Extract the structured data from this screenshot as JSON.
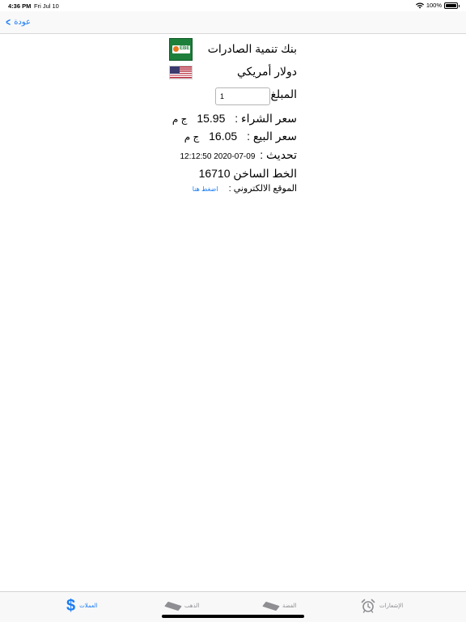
{
  "status_bar": {
    "time": "4:36 PM",
    "date": "Fri Jul 10",
    "battery": "100%",
    "battery_level": 1.0
  },
  "nav": {
    "back_label": "عودة"
  },
  "bank": {
    "name": "بنك تنمية الصادرات",
    "logo_text": "EBE",
    "currency": "دولار أمريكي",
    "amount_label": "المبلغ",
    "amount_value": "1",
    "buy_label": "سعر الشراء :",
    "buy_value": "15.95",
    "sell_label": "سعر البيع :",
    "sell_value": "16.05",
    "unit": "ج م",
    "update_label": "تحديث :",
    "update_value": "09-07-2020 12:12:50",
    "hotline_label": "الخط الساخن",
    "hotline_value": "16710",
    "website_label": "الموقع الالكتروني :",
    "website_link": "اضغط هنا"
  },
  "tabs": [
    {
      "label": "العملات",
      "icon": "dollar-icon",
      "active": true
    },
    {
      "label": "الذهب",
      "icon": "gold-bar-icon",
      "active": false
    },
    {
      "label": "الفضة",
      "icon": "silver-bar-icon",
      "active": false
    },
    {
      "label": "الإشعارات",
      "icon": "alarm-clock-icon",
      "active": false
    }
  ],
  "colors": {
    "accent": "#1a7cf3",
    "inactive": "#8e8e93"
  }
}
